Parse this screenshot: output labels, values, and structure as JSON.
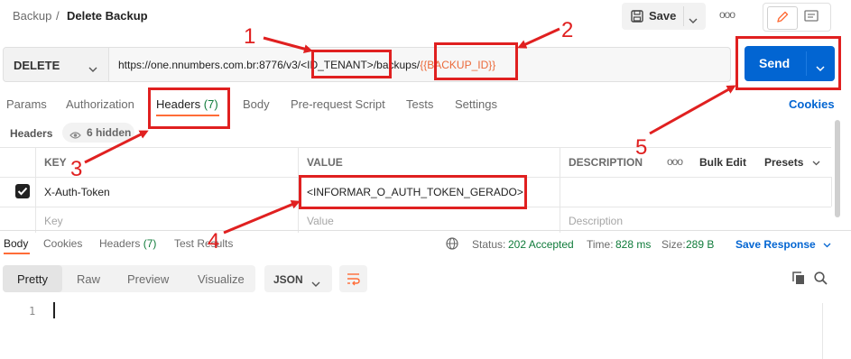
{
  "breadcrumb": {
    "parent": "Backup",
    "separator": "/",
    "current": "Delete Backup"
  },
  "toolbar": {
    "save_label": "Save",
    "more_label": "ooo"
  },
  "request": {
    "method": "DELETE",
    "url_base": "https://one.nnumbers.com.br:8776/v3/",
    "url_tenant": "<ID_TENANT>",
    "url_middle": "/backups/",
    "url_backup": "{{BACKUP_ID}}",
    "send_label": "Send"
  },
  "request_tabs": {
    "items": [
      "Params",
      "Authorization",
      "Headers",
      "Body",
      "Pre-request Script",
      "Tests",
      "Settings"
    ],
    "headers_count": "(7)",
    "cookies_label": "Cookies"
  },
  "headers_section": {
    "label": "Headers",
    "hidden_label": "6 hidden"
  },
  "table": {
    "columns": {
      "key": "KEY",
      "value": "VALUE",
      "description": "DESCRIPTION",
      "more": "ooo",
      "bulk_edit": "Bulk Edit",
      "presets": "Presets"
    },
    "rows": [
      {
        "checked": true,
        "key": "X-Auth-Token",
        "value": "<INFORMAR_O_AUTH_TOKEN_GERADO>",
        "description": ""
      }
    ],
    "placeholders": {
      "key": "Key",
      "value": "Value",
      "description": "Description"
    }
  },
  "response_tabs": {
    "items": [
      "Body",
      "Cookies",
      "Headers",
      "Test Results"
    ],
    "headers_count": "(7)"
  },
  "response_status": {
    "status_label": "Status:",
    "status_value": "202 Accepted",
    "time_label": "Time:",
    "time_value": "828 ms",
    "size_label": "Size:",
    "size_value": "289 B",
    "save_response_label": "Save Response"
  },
  "view_tabs": {
    "items": [
      "Pretty",
      "Raw",
      "Preview",
      "Visualize"
    ],
    "format": "JSON"
  },
  "editor": {
    "line_number": "1"
  },
  "annotations": {
    "labels": [
      "1",
      "2",
      "3",
      "4",
      "5"
    ],
    "color": "#e02020"
  },
  "colors": {
    "accent": "#ff6c37",
    "send": "#0265d2",
    "success": "#0f7b3a",
    "link": "#0265d2",
    "variable": "#eb6a3a"
  }
}
